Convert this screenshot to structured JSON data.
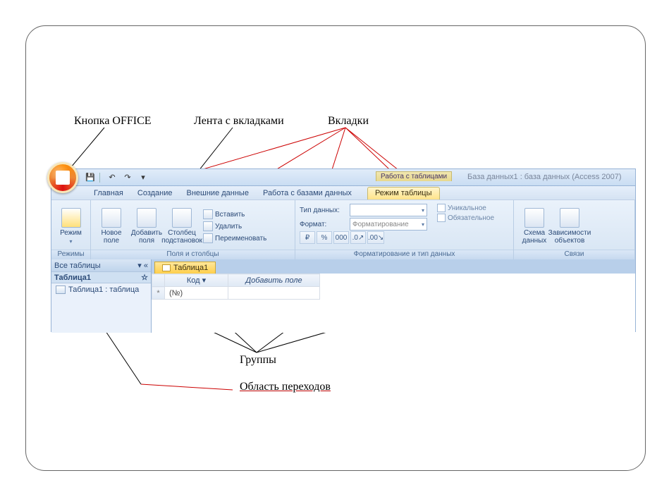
{
  "annotations": {
    "office": "Кнопка OFFICE",
    "ribbon": "Лента с вкладками",
    "tabs": "Вкладки",
    "groups": "Группы",
    "nav": "Область переходов"
  },
  "title": {
    "tools_caption": "Работа с таблицами",
    "window": "База данных1 : база данных (Access 2007)"
  },
  "qat": {
    "save_icon": "💾",
    "undo_icon": "↶",
    "redo_icon": "↷",
    "dd": "▾"
  },
  "tabs": {
    "home": "Главная",
    "create": "Создание",
    "external": "Внешние данные",
    "dbtools": "Работа с базами данных",
    "tablemode": "Режим таблицы"
  },
  "ribbon": {
    "group_views": "Режимы",
    "views_btn": "Режим",
    "group_cols": "Поля и столбцы",
    "newfield": "Новое поле",
    "addfields": "Добавить поля",
    "lookup": "Столбец подстановок",
    "insert": "Вставить",
    "delete": "Удалить",
    "rename": "Переименовать",
    "group_fmt": "Форматирование и тип данных",
    "datatype_lbl": "Тип данных:",
    "format_lbl": "Формат:",
    "fmt_placeholder": "Форматирование",
    "pct": "%",
    "thou": "000",
    "dec_inc": ".0↗",
    "dec_dec": ".00↘",
    "cur": "₽",
    "unique": "Уникальное",
    "required": "Обязательное",
    "group_rel": "Связи",
    "schema": "Схема данных",
    "deps": "Зависимости объектов"
  },
  "nav": {
    "header": "Все таблицы",
    "collapse": "«",
    "group": "Таблица1",
    "item": "Таблица1 : таблица",
    "chev": "▾",
    "chev2": "☆"
  },
  "datasheet": {
    "tabname": "Таблица1",
    "col_id": "Код",
    "col_add": "Добавить поле",
    "dd": "▾",
    "newrow": "*",
    "autonum": "(№)"
  }
}
